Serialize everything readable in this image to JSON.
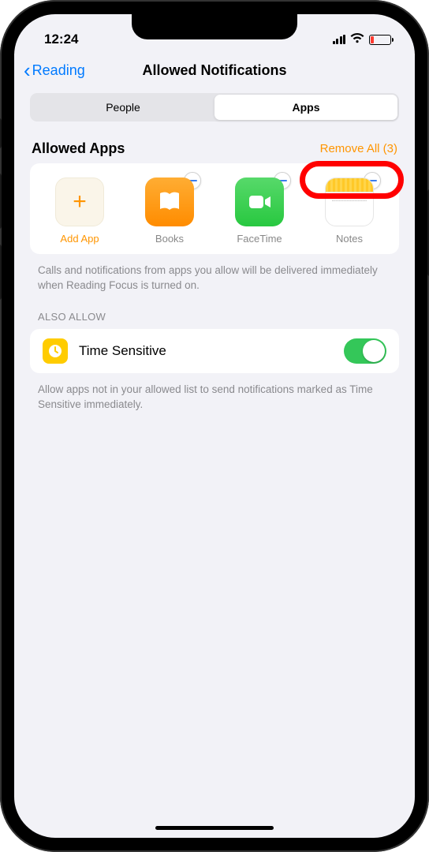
{
  "status": {
    "time": "12:24"
  },
  "nav": {
    "back": "Reading",
    "title": "Allowed Notifications"
  },
  "tabs": {
    "people": "People",
    "apps": "Apps"
  },
  "allowed": {
    "header": "Allowed Apps",
    "remove_all": "Remove All (3)",
    "add_label": "Add App",
    "apps": [
      "Books",
      "FaceTime",
      "Notes"
    ],
    "footer": "Calls and notifications from apps you allow will be delivered immediately when Reading Focus is turned on."
  },
  "also_allow": {
    "header": "ALSO ALLOW",
    "time_sensitive": "Time Sensitive",
    "footer": "Allow apps not in your allowed list to send notifications marked as Time Sensitive immediately."
  }
}
